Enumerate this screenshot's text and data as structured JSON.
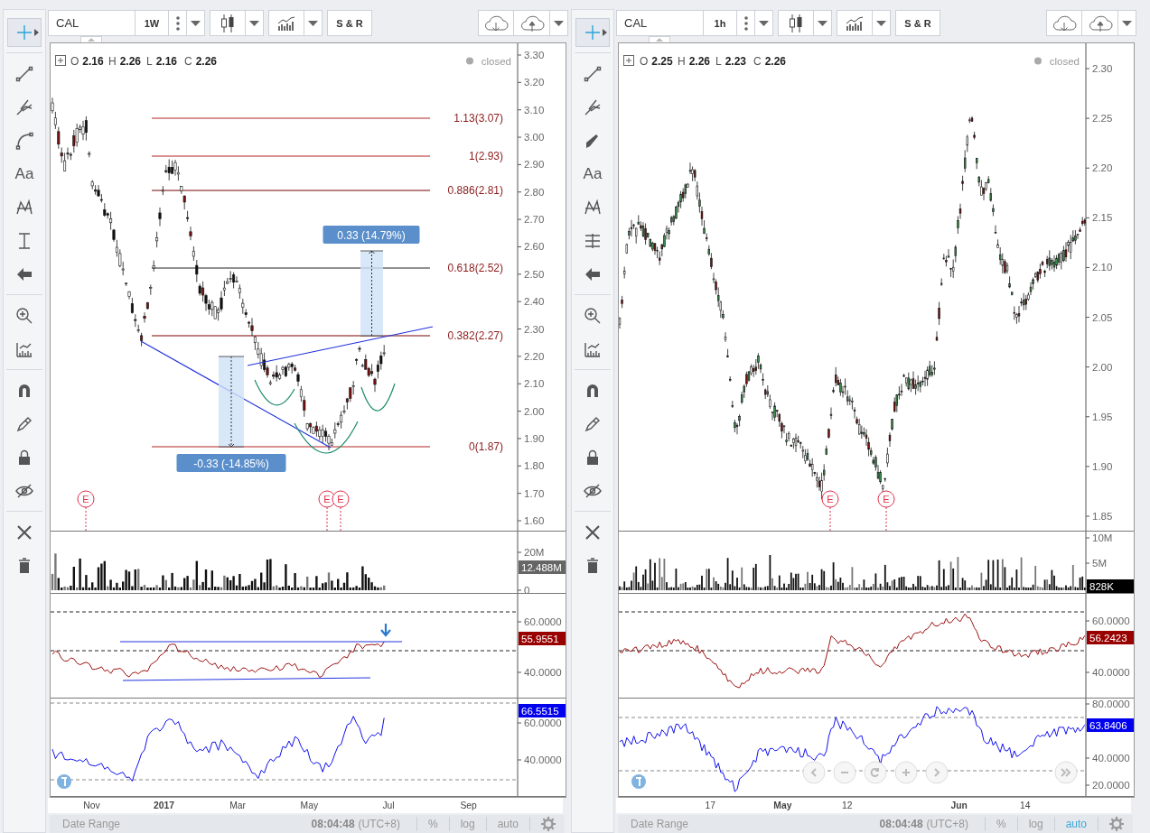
{
  "panes": [
    {
      "tool_groups": [
        [
          {
            "kind": "crosshair",
            "selected": true
          }
        ],
        [
          {
            "kind": "line",
            "selected": false
          },
          {
            "kind": "pitchfork",
            "selected": false
          },
          {
            "kind": "curve",
            "selected": false
          },
          {
            "kind": "text",
            "label": "Aa",
            "selected": false
          },
          {
            "kind": "pattern",
            "selected": false
          },
          {
            "kind": "measure",
            "selected": false
          },
          {
            "kind": "arrow",
            "selected": false
          }
        ],
        [
          {
            "kind": "zoom",
            "selected": false
          },
          {
            "kind": "ruler",
            "selected": false
          }
        ],
        [
          {
            "kind": "magnet",
            "selected": false
          },
          {
            "kind": "pencil",
            "selected": false
          },
          {
            "kind": "lock",
            "selected": false
          },
          {
            "kind": "hidden",
            "selected": false
          }
        ],
        [
          {
            "kind": "wrench",
            "selected": false
          },
          {
            "kind": "trash",
            "selected": false
          }
        ]
      ],
      "symbol": "CAL",
      "interval": "1W",
      "sr_label": "S & R",
      "legend": [
        {
          "key": "O",
          "value": "2.16"
        },
        {
          "key": "H",
          "value": "2.26"
        },
        {
          "key": "L",
          "value": "2.16"
        },
        {
          "key": "C",
          "value": "2.26"
        }
      ],
      "status": "closed",
      "price_ticks": [
        "3.30",
        "3.20",
        "3.10",
        "3.00",
        "2.90",
        "2.80",
        "2.70",
        "2.60",
        "2.50",
        "2.40",
        "2.30",
        "2.20",
        "2.10",
        "2.00",
        "1.90",
        "1.80",
        "1.70",
        "1.60"
      ],
      "fib_levels": [
        "1.13(3.07)",
        "1(2.93)",
        "0.886(2.81)",
        "0.618(2.52)",
        "0.382(2.27)",
        "0(1.87)"
      ],
      "measurements": [
        "0.33 (14.79%)",
        "-0.33 (-14.85%)"
      ],
      "earnings": [
        "E",
        "E",
        "E"
      ],
      "volume": {
        "ticks": [
          "20M",
          "0"
        ],
        "last": "12.488M"
      },
      "rsi": {
        "ticks": [
          "60.0000",
          "40.0000"
        ],
        "last": "55.9551"
      },
      "oscillator": {
        "ticks": [
          "60.0000",
          "40.0000"
        ],
        "last": "66.5515"
      },
      "time_ticks": [
        {
          "label": "Nov",
          "major": false
        },
        {
          "label": "2017",
          "major": true
        },
        {
          "label": "Mar",
          "major": false
        },
        {
          "label": "May",
          "major": false
        },
        {
          "label": "Jul",
          "major": false
        },
        {
          "label": "Sep",
          "major": false
        }
      ],
      "status_bar": {
        "date_range": "Date Range",
        "time": "08:04:48",
        "timezone": "(UTC+8)",
        "toggles": [
          {
            "label": "%",
            "selected": false
          },
          {
            "label": "log",
            "selected": false
          },
          {
            "label": "auto",
            "selected": false
          }
        ]
      }
    },
    {
      "tool_groups": [
        [
          {
            "kind": "crosshair",
            "selected": true
          }
        ],
        [
          {
            "kind": "line",
            "selected": false
          },
          {
            "kind": "pitchfork",
            "selected": false
          },
          {
            "kind": "brush",
            "selected": false
          },
          {
            "kind": "text",
            "label": "Aa",
            "selected": false
          },
          {
            "kind": "pattern",
            "selected": false
          },
          {
            "kind": "fib",
            "selected": false
          },
          {
            "kind": "arrow",
            "selected": false
          }
        ],
        [
          {
            "kind": "zoom",
            "selected": false
          },
          {
            "kind": "ruler",
            "selected": false
          }
        ],
        [
          {
            "kind": "magnet",
            "selected": false
          },
          {
            "kind": "pencil",
            "selected": false
          },
          {
            "kind": "lock",
            "selected": false
          },
          {
            "kind": "hidden",
            "selected": false
          }
        ],
        [
          {
            "kind": "wrench",
            "selected": false
          },
          {
            "kind": "trash",
            "selected": false
          }
        ]
      ],
      "symbol": "CAL",
      "interval": "1h",
      "sr_label": "S & R",
      "legend": [
        {
          "key": "O",
          "value": "2.25"
        },
        {
          "key": "H",
          "value": "2.26"
        },
        {
          "key": "L",
          "value": "2.23"
        },
        {
          "key": "C",
          "value": "2.26"
        }
      ],
      "status": "closed",
      "price_ticks": [
        "2.30",
        "2.25",
        "2.20",
        "2.15",
        "2.10",
        "2.05",
        "2.00",
        "1.95",
        "1.90",
        "1.85"
      ],
      "earnings": [
        "E",
        "E"
      ],
      "volume": {
        "ticks": [
          "10M",
          "5M"
        ],
        "last": "828K"
      },
      "rsi": {
        "ticks": [
          "60.0000",
          "40.0000"
        ],
        "last": "56.2423"
      },
      "oscillator": {
        "ticks": [
          "80.0000",
          "40.0000",
          "20.0000"
        ],
        "last": "63.8406"
      },
      "navigation": [
        {
          "kind": "back"
        },
        {
          "kind": "zoom_out"
        },
        {
          "kind": "reset"
        },
        {
          "kind": "zoom_in"
        },
        {
          "kind": "forward"
        },
        {
          "kind": "scroll_end"
        }
      ],
      "time_ticks": [
        {
          "label": "17",
          "major": false
        },
        {
          "label": "May",
          "major": true
        },
        {
          "label": "12",
          "major": false
        },
        {
          "label": "Jun",
          "major": true
        },
        {
          "label": "14",
          "major": false
        }
      ],
      "status_bar": {
        "date_range": "Date Range",
        "time": "08:04:48",
        "timezone": "(UTC+8)",
        "toggles": [
          {
            "label": "%",
            "selected": false
          },
          {
            "label": "log",
            "selected": false
          },
          {
            "label": "auto",
            "selected": true
          }
        ]
      }
    }
  ]
}
